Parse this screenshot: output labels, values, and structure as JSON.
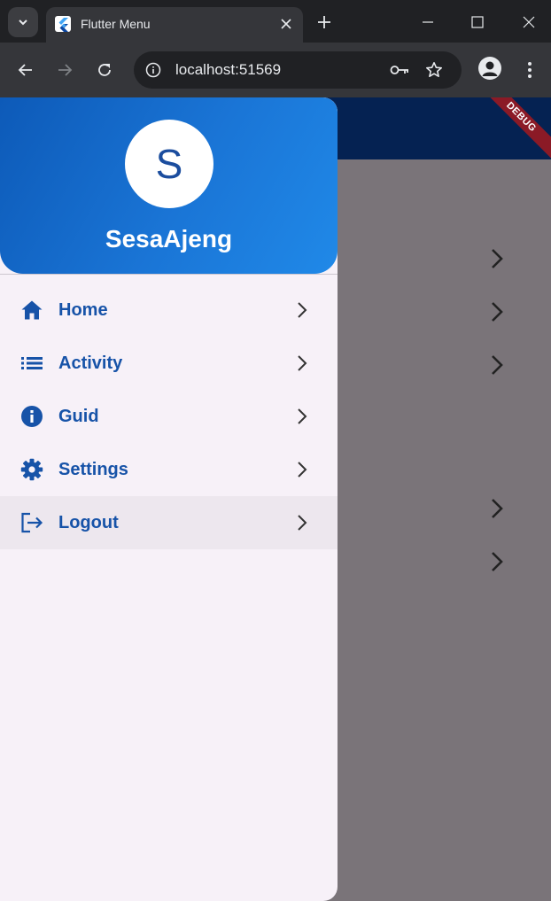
{
  "browser": {
    "tab": {
      "title": "Flutter Menu"
    },
    "address_bar": {
      "url": "localhost:51569"
    }
  },
  "app": {
    "debug_banner": "DEBUG",
    "colors": {
      "app_bar": "#052252",
      "accent": "#1753a8",
      "drawer_bg": "#f7f1f8"
    }
  },
  "drawer": {
    "avatar_letter": "S",
    "username": "SesaAjeng",
    "items": [
      {
        "label": "Home",
        "icon": "home-icon"
      },
      {
        "label": "Activity",
        "icon": "list-icon"
      },
      {
        "label": "Guid",
        "icon": "info-icon"
      },
      {
        "label": "Settings",
        "icon": "gear-icon"
      },
      {
        "label": "Logout",
        "icon": "logout-icon",
        "selected": true
      }
    ]
  }
}
